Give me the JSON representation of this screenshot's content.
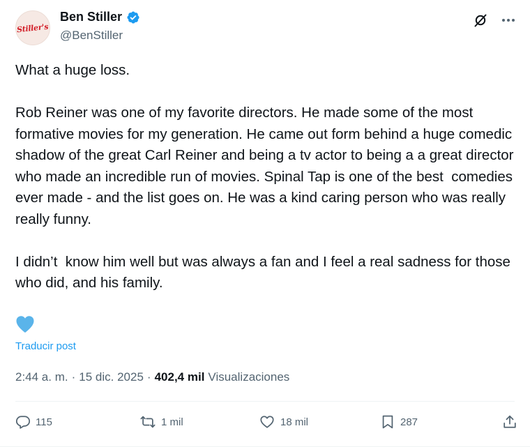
{
  "author": {
    "display_name": "Ben Stiller",
    "handle": "@BenStiller",
    "avatar_text": "Stiller's",
    "verified": true,
    "verified_color": "#1d9bf0"
  },
  "post": {
    "paragraphs": [
      "What a huge loss.",
      "Rob Reiner was one of my favorite directors. He made some of the most formative movies for my generation. He came out form behind a huge comedic shadow of the great Carl Reiner and being a tv actor to being a a great director who made an incredible run of movies. Spinal Tap is one of the best  comedies ever made - and the list goes on. He was a kind caring person who was really really funny.",
      "I didn’t  know him well but was always a fan and I feel a real sadness for those who did, and his family."
    ],
    "emoji": "blue-heart-emoji",
    "translate_label": "Traducir post"
  },
  "meta": {
    "time": "2:44 a. m.",
    "separator": "·",
    "date": "15 dic. 2025",
    "views_count": "402,4 mil",
    "views_label": "Visualizaciones"
  },
  "actions": {
    "replies": "115",
    "reposts": "1 mil",
    "likes": "18 mil",
    "bookmarks": "287"
  },
  "colors": {
    "accent": "#1d9bf0",
    "muted": "#536471",
    "text": "#0f1419",
    "heart_emoji": "#5ab4ea"
  }
}
